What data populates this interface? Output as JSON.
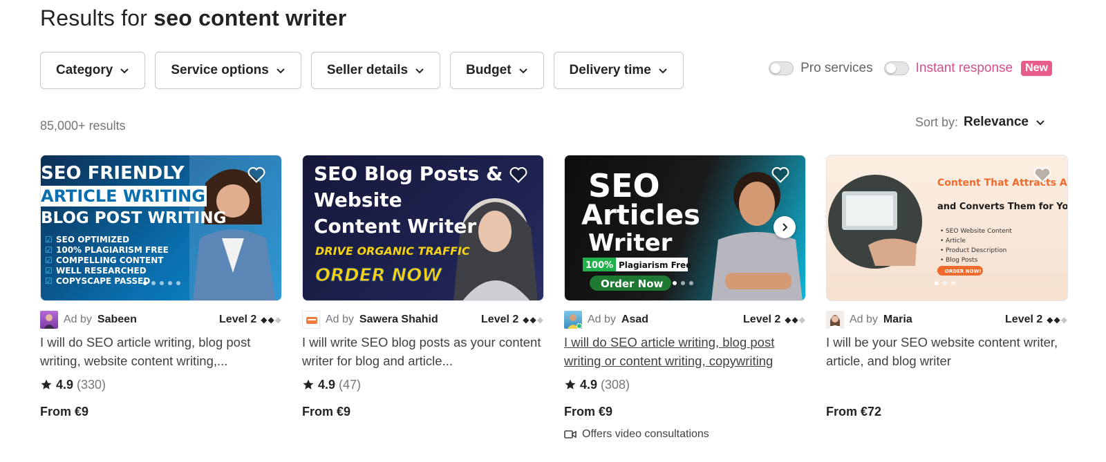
{
  "header": {
    "prefix": "Results for",
    "query": "seo content writer"
  },
  "filters": [
    "Category",
    "Service options",
    "Seller details",
    "Budget",
    "Delivery time"
  ],
  "toggles": {
    "pro_label": "Pro services",
    "instant_label": "Instant response",
    "new_badge": "New"
  },
  "results": {
    "count_text": "85,000+ results",
    "sort_label": "Sort by:",
    "sort_value": "Relevance"
  },
  "gigs": [
    {
      "ad_prefix": "Ad by",
      "seller": "Sabeen",
      "level": "Level 2",
      "title": "I will do SEO article writing, blog post writing, website content writing,...",
      "score": "4.9",
      "reviews": "(330)",
      "price": "From €9",
      "thumb": {
        "line1": "SEO FRIENDLY",
        "line2": "ARTICLE WRITING",
        "line3": "BLOG POST WRITING",
        "bullets": [
          "SEO OPTIMIZED",
          "100% PLAGIARISM FREE",
          "COMPELLING CONTENT",
          "WELL RESEARCHED",
          "COPYSCAPE PASSED"
        ]
      }
    },
    {
      "ad_prefix": "Ad by",
      "seller": "Sawera Shahid",
      "level": "Level 2",
      "title": "I will write SEO blog posts as your content writer for blog and article...",
      "score": "4.9",
      "reviews": "(47)",
      "price": "From €9",
      "thumb": {
        "line1": "SEO Blog Posts &",
        "line2": "Website",
        "line3": "Content Writer",
        "line4": "DRIVE ORGANIC TRAFFIC",
        "line5": "ORDER NOW"
      }
    },
    {
      "ad_prefix": "Ad by",
      "seller": "Asad",
      "level": "Level 2",
      "title": "I will do SEO article writing, blog post writing or content writing, copywriting",
      "score": "4.9",
      "reviews": "(308)",
      "price": "From €9",
      "video_offer": "Offers video consultations",
      "thumb": {
        "line1": "SEO",
        "line2": "Articles",
        "line3": "Writer",
        "badge_bold": "100%",
        "badge_rest": "Plagiarism Free",
        "cta": "Order Now"
      }
    },
    {
      "ad_prefix": "Ad by",
      "seller": "Maria",
      "level": "Level 2",
      "title": "I will be your SEO website content writer, article, and blog writer",
      "price": "From €72",
      "thumb": {
        "headline_orange": "Content That Attracts Audience",
        "headline_dark": "and Converts Them for You!",
        "bullets": [
          "SEO Website Content",
          "Article",
          "Product Description",
          "Blog Posts"
        ],
        "cta": "ORDER NOW!"
      }
    }
  ]
}
